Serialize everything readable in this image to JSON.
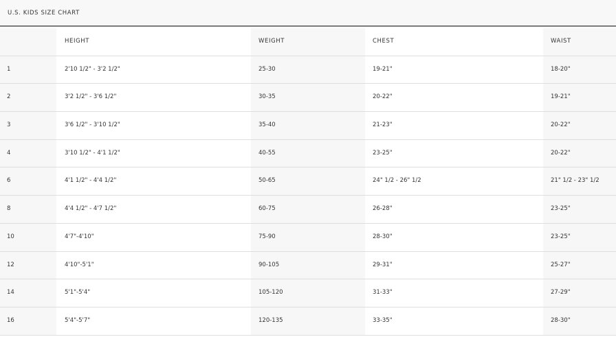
{
  "title": "U.S. KIDS SIZE CHART",
  "headers": [
    "",
    "HEIGHT",
    "WEIGHT",
    "CHEST",
    "WAIST"
  ],
  "rows": [
    [
      "1",
      "2'10 1/2\" - 3'2 1/2\"",
      "25-30",
      "19-21\"",
      "18-20\""
    ],
    [
      "2",
      "3'2 1/2\" - 3'6 1/2\"",
      "30-35",
      "20-22\"",
      "19-21\""
    ],
    [
      "3",
      "3'6 1/2\" - 3'10 1/2\"",
      "35-40",
      "21-23\"",
      "20-22\""
    ],
    [
      "4",
      "3'10 1/2\" - 4'1 1/2\"",
      "40-55",
      "23-25\"",
      "20-22\""
    ],
    [
      "6",
      "4'1 1/2\" - 4'4 1/2\"",
      "50-65",
      "24\" 1/2 - 26\" 1/2",
      "21\" 1/2 - 23\" 1/2"
    ],
    [
      "8",
      "4'4 1/2\" - 4'7 1/2\"",
      "60-75",
      "26-28\"",
      "23-25\""
    ],
    [
      "10",
      "4'7\"-4'10\"",
      "75-90",
      "28-30\"",
      "23-25\""
    ],
    [
      "12",
      "4'10\"-5'1\"",
      "90-105",
      "29-31\"",
      "25-27\""
    ],
    [
      "14",
      "5'1\"-5'4\"",
      "105-120",
      "31-33\"",
      "27-29\""
    ],
    [
      "16",
      "5'4\"-5'7\"",
      "120-135",
      "33-35\"",
      "28-30\""
    ]
  ]
}
